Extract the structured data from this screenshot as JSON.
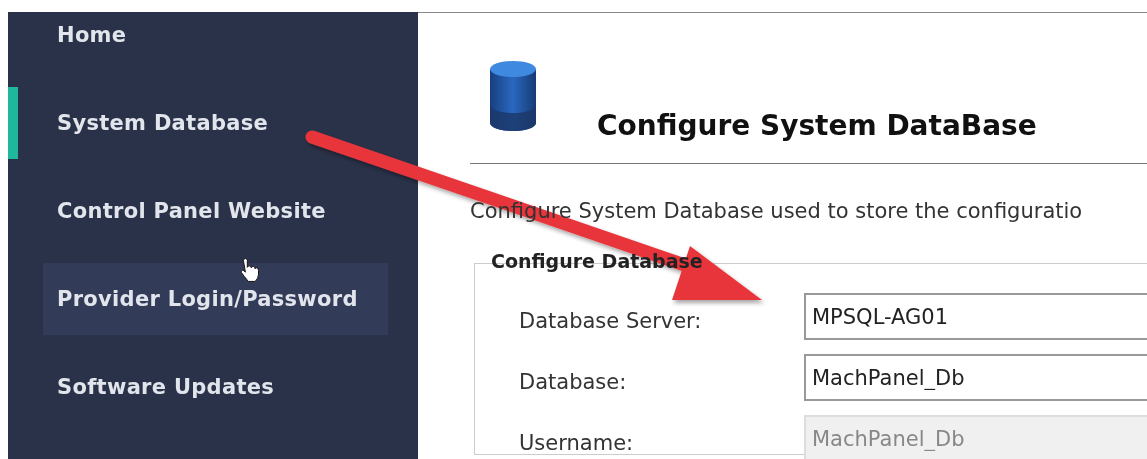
{
  "sidebar": {
    "items": [
      {
        "label": "Home",
        "selected": false,
        "hovered": false
      },
      {
        "label": "System Database",
        "selected": true,
        "hovered": false
      },
      {
        "label": "Control Panel Website",
        "selected": false,
        "hovered": false
      },
      {
        "label": "Provider Login/Password",
        "selected": false,
        "hovered": true
      },
      {
        "label": "Software Updates",
        "selected": false,
        "hovered": false
      }
    ]
  },
  "header": {
    "title": "Configure System DataBase"
  },
  "description": "Configure System Database used to store the configuratio",
  "group": {
    "legend": "Configure Database",
    "fields": [
      {
        "label": "Database Server:",
        "value": "MPSQL-AG01",
        "disabled": false
      },
      {
        "label": "Database:",
        "value": "MachPanel_Db",
        "disabled": false
      },
      {
        "label": "Username:",
        "value": "MachPanel_Db",
        "disabled": true
      }
    ]
  }
}
